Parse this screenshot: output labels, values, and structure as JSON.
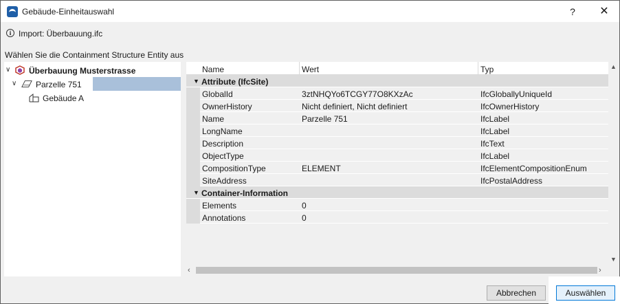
{
  "window": {
    "title": "Gebäude-Einheitauswahl",
    "help_label": "?",
    "close_label": "✕"
  },
  "import_text": "Import: Überbauung.ifc",
  "prompt": "Wählen Sie die Containment Structure Entity aus",
  "tree": [
    {
      "label": "Überbauung Musterstrasse",
      "icon": "project-icon",
      "expanded": true
    },
    {
      "label": "Parzelle 751",
      "icon": "site-icon",
      "expanded": true,
      "selected": true
    },
    {
      "label": "Gebäude A",
      "icon": "building-icon"
    }
  ],
  "grid": {
    "columns": [
      "Name",
      "Wert",
      "Typ"
    ],
    "groups": [
      {
        "label": "Attribute (IfcSite)",
        "rows": [
          {
            "name": "GlobalId",
            "value": "3ztNHQYo6TCGY77O8KXzAc",
            "type": "IfcGloballyUniqueId"
          },
          {
            "name": "OwnerHistory",
            "value": "Nicht definiert, Nicht definiert",
            "type": "IfcOwnerHistory"
          },
          {
            "name": "Name",
            "value": "Parzelle 751",
            "type": "IfcLabel"
          },
          {
            "name": "LongName",
            "value": "",
            "type": "IfcLabel"
          },
          {
            "name": "Description",
            "value": "",
            "type": "IfcText"
          },
          {
            "name": "ObjectType",
            "value": "",
            "type": "IfcLabel"
          },
          {
            "name": "CompositionType",
            "value": "ELEMENT",
            "type": "IfcElementCompositionEnum"
          },
          {
            "name": "SiteAddress",
            "value": "",
            "type": "IfcPostalAddress"
          }
        ]
      },
      {
        "label": "Container-Information",
        "rows": [
          {
            "name": "Elements",
            "value": "0",
            "type": ""
          },
          {
            "name": "Annotations",
            "value": "0",
            "type": ""
          }
        ]
      }
    ]
  },
  "buttons": {
    "cancel": "Abbrechen",
    "ok": "Auswählen"
  },
  "colors": {
    "selection": "#a9c0da",
    "accent": "#0078d7",
    "group_row": "#dcdcdc"
  }
}
